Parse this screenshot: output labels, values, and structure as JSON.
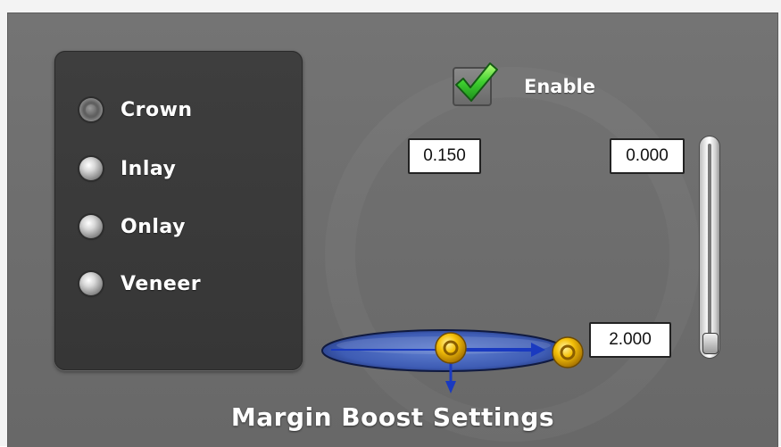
{
  "prep_types": {
    "items": [
      {
        "label": "Crown",
        "selected": true
      },
      {
        "label": "Inlay",
        "selected": false
      },
      {
        "label": "Onlay",
        "selected": false
      },
      {
        "label": "Veneer",
        "selected": false
      }
    ]
  },
  "enable": {
    "label": "Enable",
    "checked": true
  },
  "fields": {
    "left_value": "0.150",
    "right_value": "0.000",
    "bottom_value": "2.000"
  },
  "slider": {
    "level": 0.0
  },
  "panel": {
    "title": "Margin Boost Settings"
  },
  "icons": {
    "check": "checkmark-icon",
    "handle": "control-handle-icon"
  },
  "colors": {
    "panel_bg": "#6e6e6e",
    "radio_box_bg": "#3a3a3a",
    "check_green": "#2fbf2f",
    "diagram_blue": "#2a3fa8",
    "handle_gold": "#f2b400"
  }
}
